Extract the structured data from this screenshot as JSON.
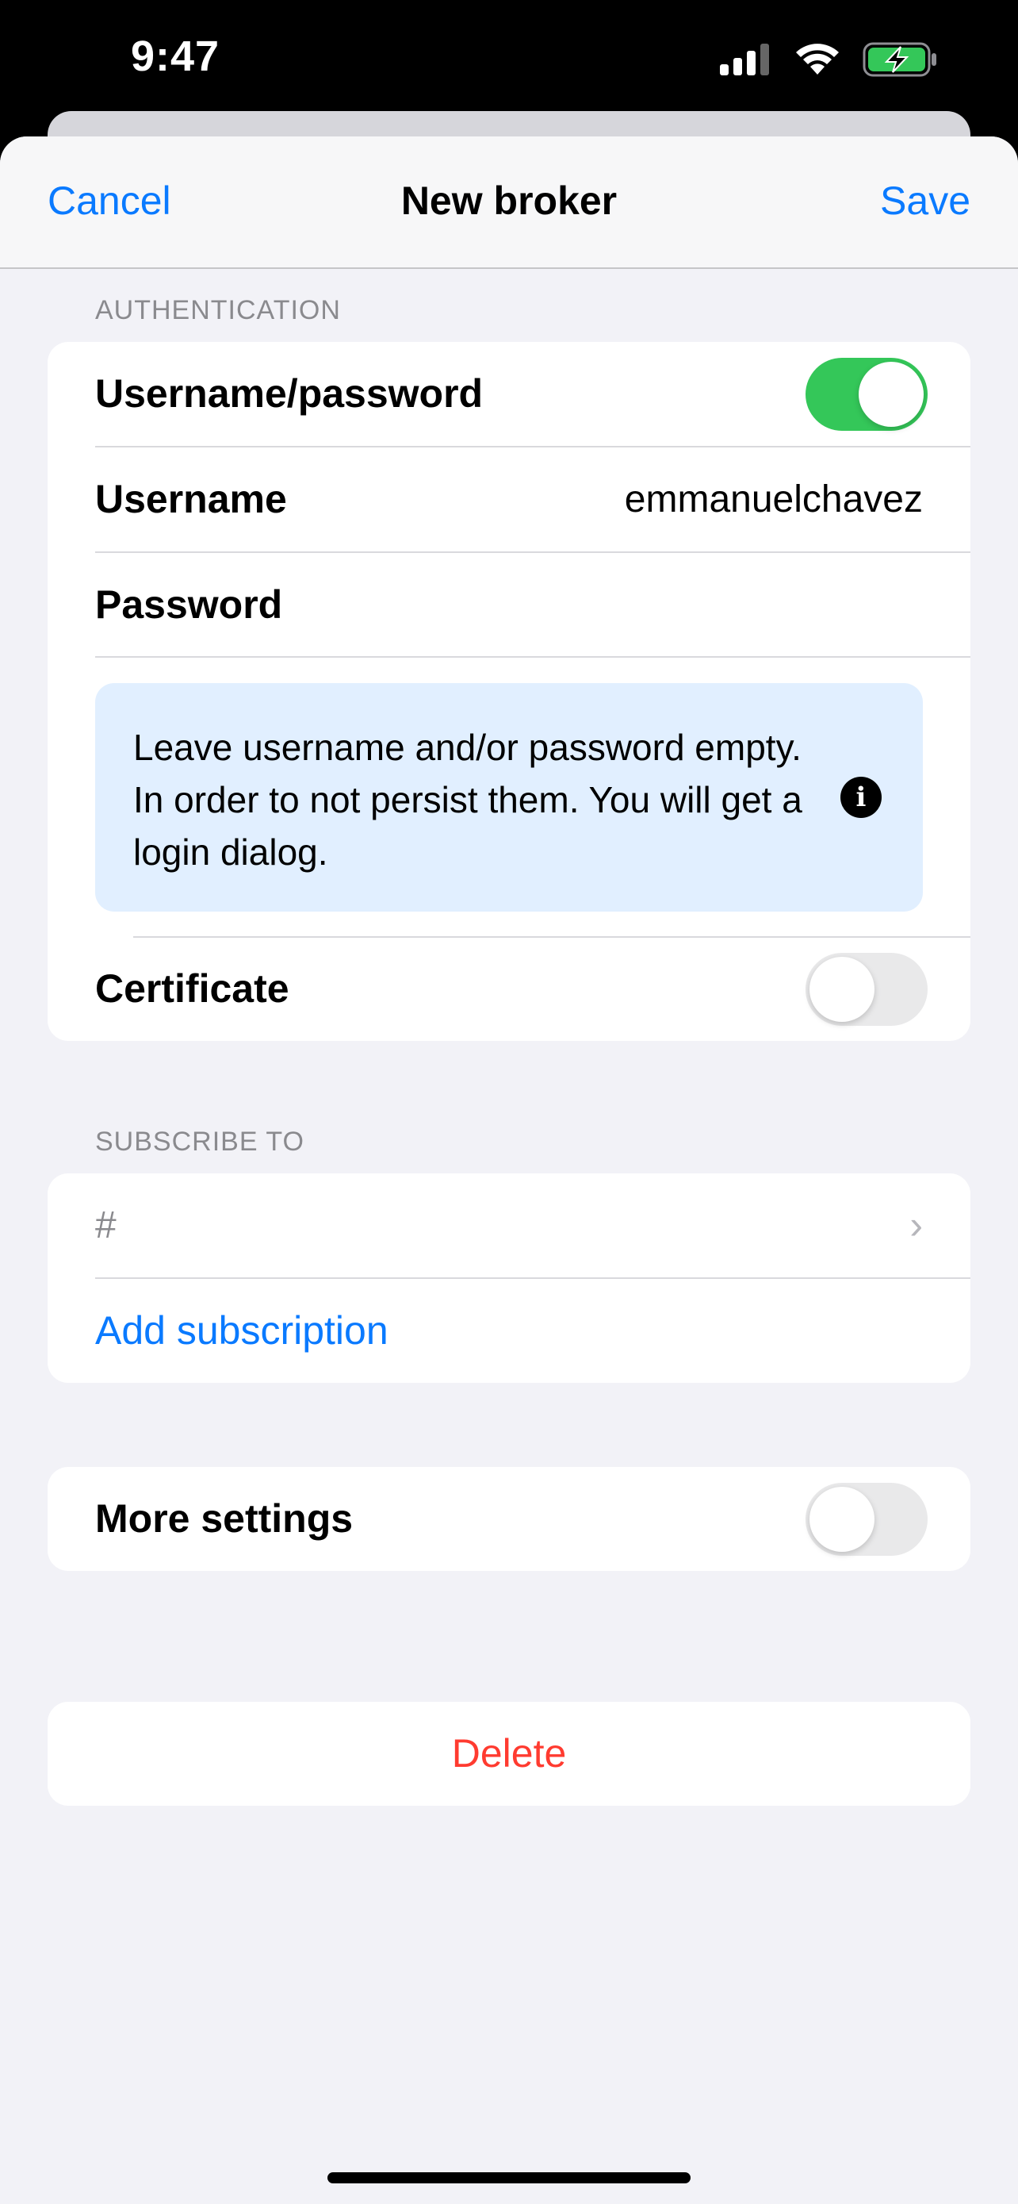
{
  "status_bar": {
    "time": "9:47"
  },
  "navbar": {
    "cancel": "Cancel",
    "title": "New broker",
    "save": "Save"
  },
  "authentication": {
    "header": "AUTHENTICATION",
    "username_password_label": "Username/password",
    "username_password_enabled": true,
    "username_label": "Username",
    "username_value": "emmanuelchavez",
    "password_label": "Password",
    "info_text": "Leave username and/or password empty. In order to not persist them. You will get a login dialog.",
    "certificate_label": "Certificate",
    "certificate_enabled": false
  },
  "subscribe": {
    "header": "SUBSCRIBE TO",
    "topics": [
      "#"
    ],
    "add_label": "Add subscription"
  },
  "more_settings": {
    "label": "More settings",
    "enabled": false
  },
  "delete_label": "Delete",
  "colors": {
    "accent": "#0a7aff",
    "toggle_on": "#34c759",
    "destructive": "#ff3b30",
    "info_bg": "#e1efff"
  }
}
